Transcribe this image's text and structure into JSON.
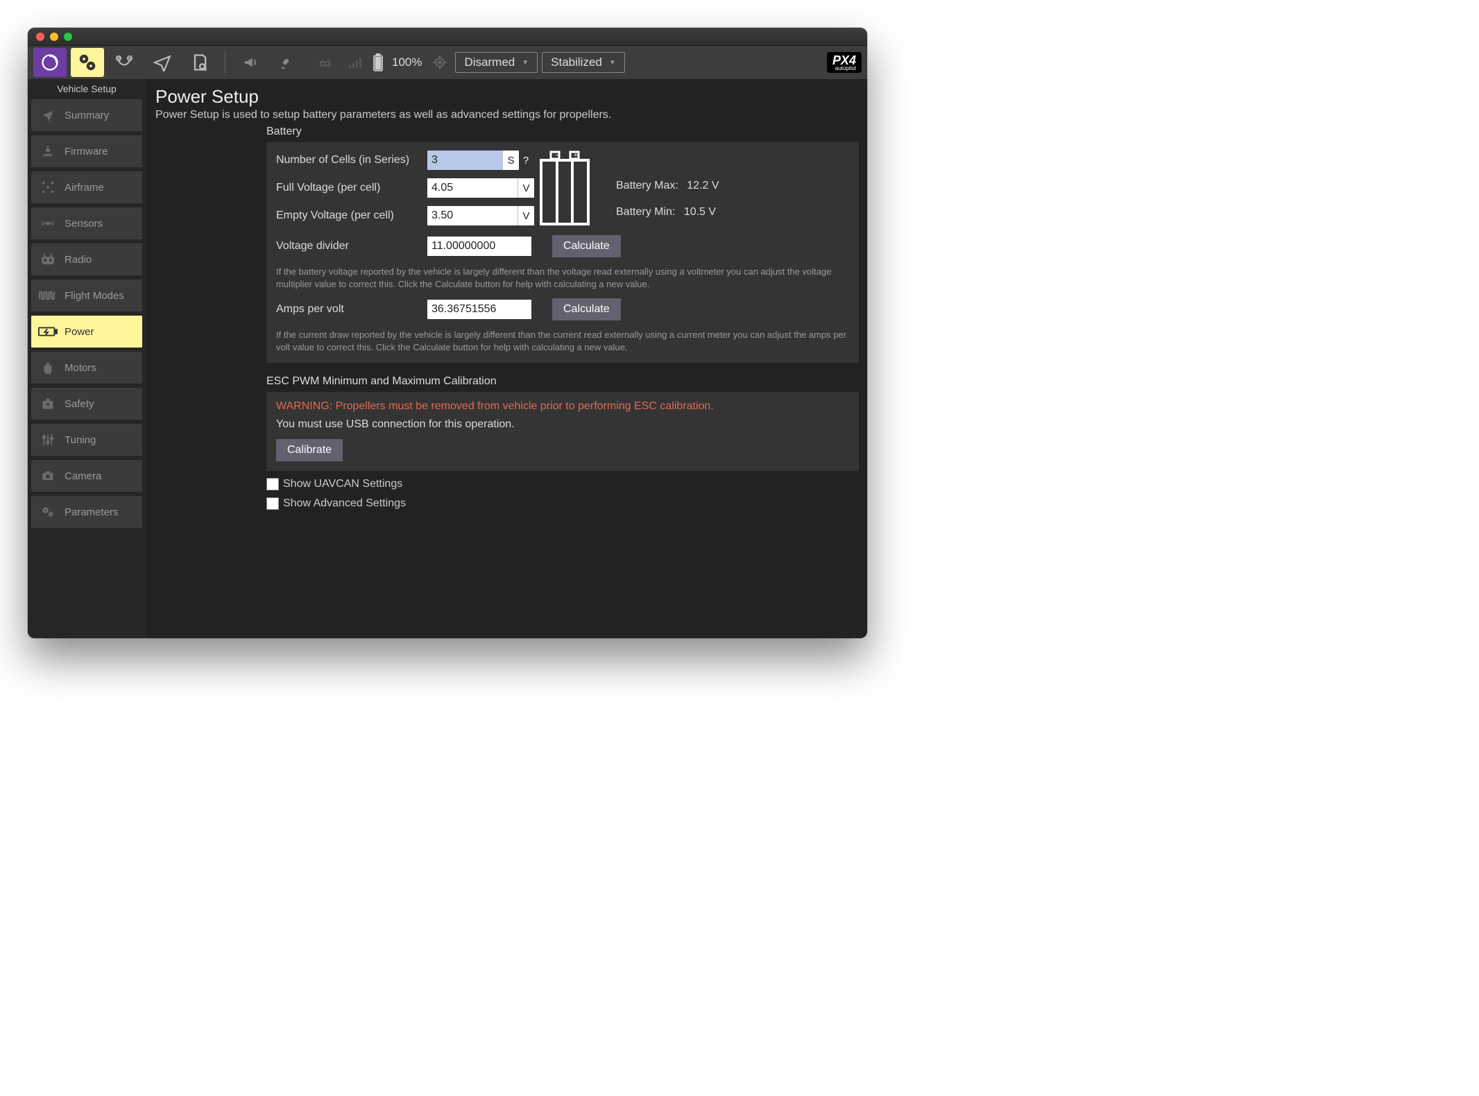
{
  "toolbar": {
    "battery_pct": "100%",
    "armed_state": "Disarmed",
    "flight_mode": "Stabilized",
    "logo": "PX4",
    "logo_sub": "autopilot"
  },
  "sidebar": {
    "title": "Vehicle Setup",
    "items": [
      {
        "label": "Summary"
      },
      {
        "label": "Firmware"
      },
      {
        "label": "Airframe"
      },
      {
        "label": "Sensors"
      },
      {
        "label": "Radio"
      },
      {
        "label": "Flight Modes"
      },
      {
        "label": "Power"
      },
      {
        "label": "Motors"
      },
      {
        "label": "Safety"
      },
      {
        "label": "Tuning"
      },
      {
        "label": "Camera"
      },
      {
        "label": "Parameters"
      }
    ]
  },
  "page": {
    "title": "Power Setup",
    "subtitle": "Power Setup is used to setup battery parameters as well as advanced settings for propellers."
  },
  "battery": {
    "section": "Battery",
    "cells_label": "Number of Cells (in Series)",
    "cells_value": "3",
    "cells_unit": "S",
    "help_mark": "?",
    "full_label": "Full Voltage (per cell)",
    "full_value": "4.05",
    "empty_label": "Empty Voltage (per cell)",
    "empty_value": "3.50",
    "v_unit": "V",
    "max_label": "Battery Max:",
    "max_value": "12.2 V",
    "min_label": "Battery Min:",
    "min_value": "10.5 V",
    "vdiv_label": "Voltage divider",
    "vdiv_value": "11.00000000",
    "calc_btn": "Calculate",
    "vdiv_help": "If the battery voltage reported by the vehicle is largely different than the voltage read externally using a voltmeter you can adjust the voltage multiplier value to correct this. Click the Calculate button for help with calculating a new value.",
    "amps_label": "Amps per volt",
    "amps_value": "36.36751556",
    "amps_help": "If the current draw reported by the vehicle is largely different than the current read externally using a current meter you can adjust the amps per volt value to correct this. Click the Calculate button for help with calculating a new value."
  },
  "esc": {
    "section": "ESC PWM Minimum and Maximum Calibration",
    "warning": "WARNING: Propellers must be removed from vehicle prior to performing ESC calibration.",
    "note": "You must use USB connection for this operation.",
    "calibrate_btn": "Calibrate"
  },
  "checks": {
    "uavcan": "Show UAVCAN Settings",
    "advanced": "Show Advanced Settings"
  }
}
